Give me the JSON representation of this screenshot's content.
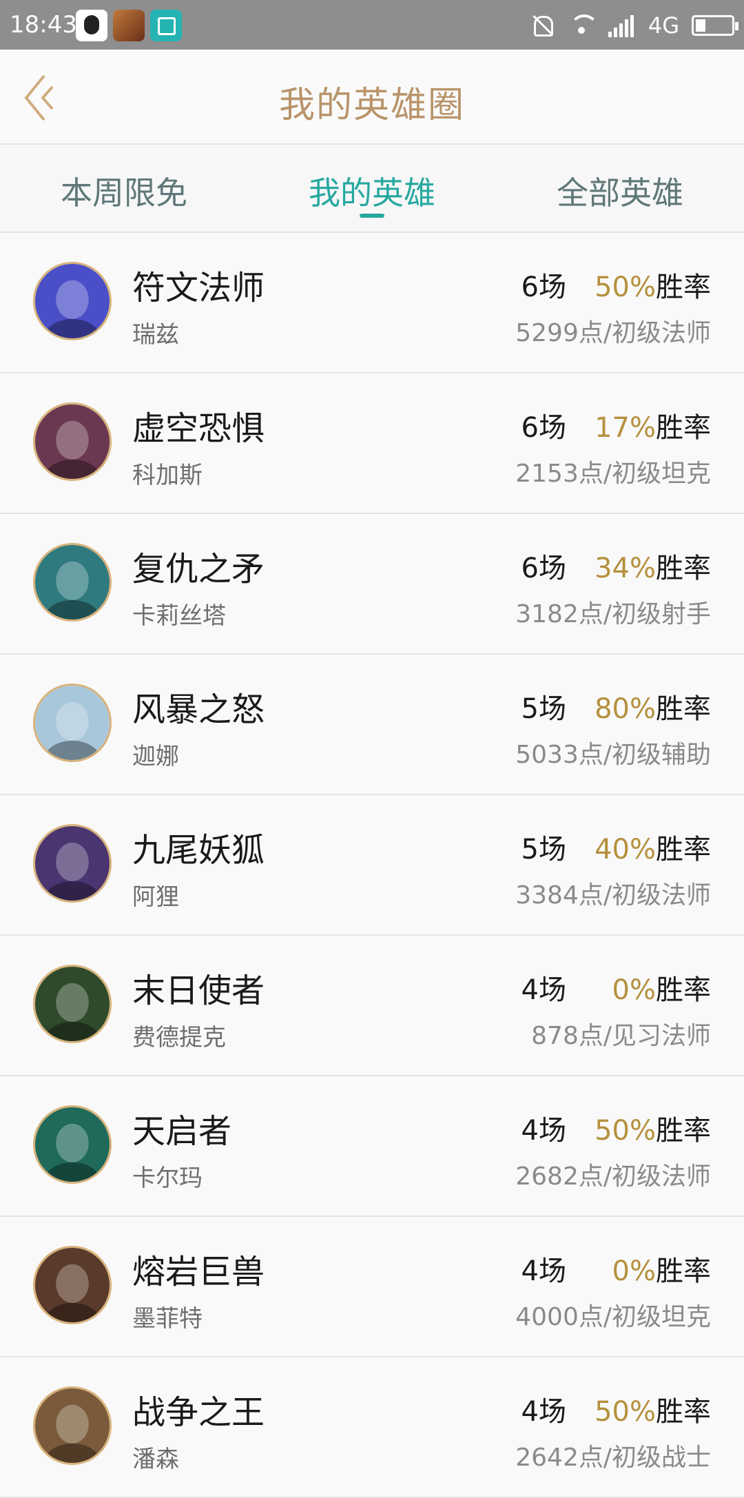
{
  "status_bar": {
    "time": "18:43",
    "network": "4G",
    "icons": [
      "qq-icon",
      "game-app-icon",
      "scan-icon",
      "mute-bell-icon",
      "wifi-icon",
      "signal-icon",
      "battery-icon"
    ]
  },
  "header": {
    "title": "我的英雄圈",
    "back_icon": "chevron-left-icon",
    "accent_color": "#b9946a"
  },
  "tabs": [
    {
      "label": "本周限免",
      "active": false
    },
    {
      "label": "我的英雄",
      "active": true
    },
    {
      "label": "全部英雄",
      "active": false
    }
  ],
  "tab_active_color": "#26a8a0",
  "heroes": [
    {
      "name": "符文法师",
      "subname": "瑞兹",
      "games": "6场",
      "rate": "50%",
      "rate_label": "胜率",
      "points": "5299点/初级法师",
      "avatar_color": "#4a4fc8"
    },
    {
      "name": "虚空恐惧",
      "subname": "科加斯",
      "games": "6场",
      "rate": "17%",
      "rate_label": "胜率",
      "points": "2153点/初级坦克",
      "avatar_color": "#6a3850"
    },
    {
      "name": "复仇之矛",
      "subname": "卡莉丝塔",
      "games": "6场",
      "rate": "34%",
      "rate_label": "胜率",
      "points": "3182点/初级射手",
      "avatar_color": "#2f7a7e"
    },
    {
      "name": "风暴之怒",
      "subname": "迦娜",
      "games": "5场",
      "rate": "80%",
      "rate_label": "胜率",
      "points": "5033点/初级辅助",
      "avatar_color": "#a9c7da"
    },
    {
      "name": "九尾妖狐",
      "subname": "阿狸",
      "games": "5场",
      "rate": "40%",
      "rate_label": "胜率",
      "points": "3384点/初级法师",
      "avatar_color": "#4a3570"
    },
    {
      "name": "末日使者",
      "subname": "费德提克",
      "games": "4场",
      "rate": "0%",
      "rate_label": "胜率",
      "points": "878点/见习法师",
      "avatar_color": "#2e4a2a"
    },
    {
      "name": "天启者",
      "subname": "卡尔玛",
      "games": "4场",
      "rate": "50%",
      "rate_label": "胜率",
      "points": "2682点/初级法师",
      "avatar_color": "#1f6a5a"
    },
    {
      "name": "熔岩巨兽",
      "subname": "墨菲特",
      "games": "4场",
      "rate": "0%",
      "rate_label": "胜率",
      "points": "4000点/初级坦克",
      "avatar_color": "#5a3a2a"
    },
    {
      "name": "战争之王",
      "subname": "潘森",
      "games": "4场",
      "rate": "50%",
      "rate_label": "胜率",
      "points": "2642点/初级战士",
      "avatar_color": "#7a5a3a"
    }
  ],
  "colors": {
    "rate": "#b5903e",
    "points": "#8a8a8a",
    "status_bar_bg": "#8e8e8e"
  }
}
